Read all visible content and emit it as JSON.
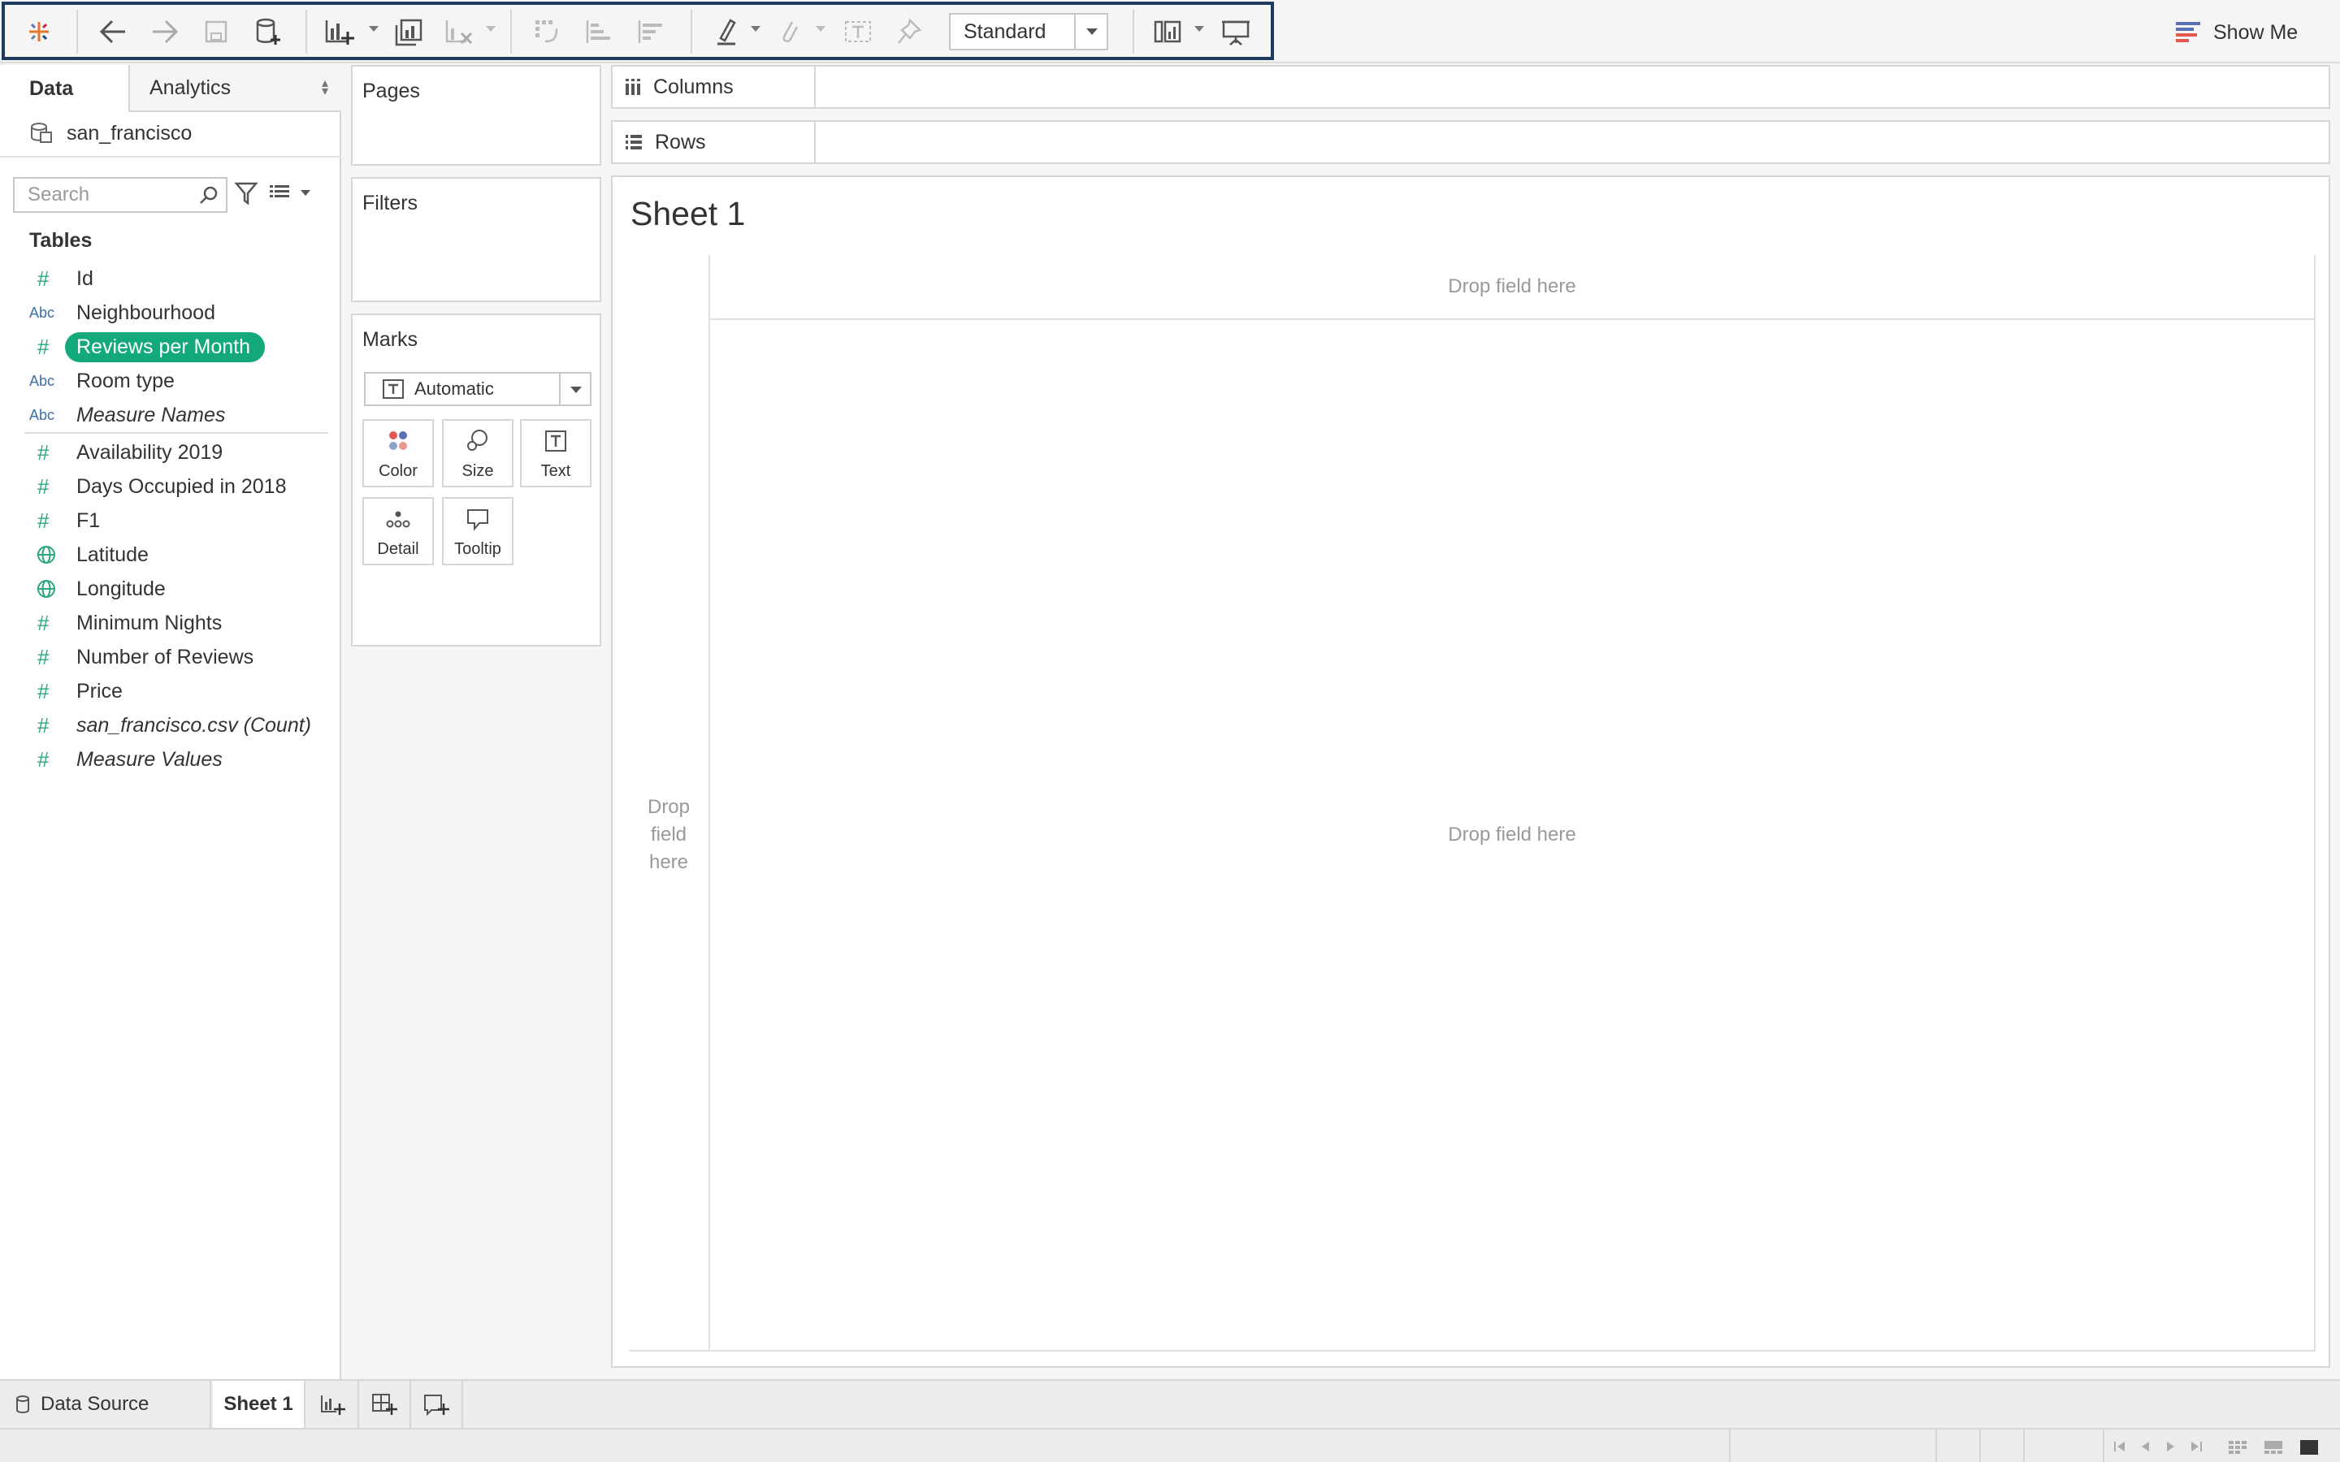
{
  "toolbar": {
    "view_size_value": "Standard",
    "show_me_label": "Show Me",
    "icons": [
      "tableau-logo-icon",
      "back-icon",
      "forward-icon",
      "save-icon",
      "new-datasource-icon",
      "new-worksheet-icon",
      "duplicate-sheet-icon",
      "clear-sheet-icon",
      "swap-icon",
      "sort-ascending-icon",
      "sort-descending-icon",
      "highlight-icon",
      "group-icon",
      "labels-icon",
      "pin-icon",
      "cards-icon",
      "presentation-icon"
    ]
  },
  "data_pane": {
    "tab_data": "Data",
    "tab_analytics": "Analytics",
    "datasource_name": "san_francisco",
    "search_placeholder": "Search",
    "tables_heading": "Tables",
    "fields": [
      {
        "type": "#",
        "label": "Id"
      },
      {
        "type": "Abc",
        "label": "Neighbourhood"
      },
      {
        "type": "#",
        "label": "Reviews per Month",
        "selected": true
      },
      {
        "type": "Abc",
        "label": "Room type"
      },
      {
        "type": "Abc",
        "label": "Measure Names",
        "italic": true
      },
      {
        "type": "#",
        "label": "Availability 2019"
      },
      {
        "type": "#",
        "label": "Days Occupied in 2018"
      },
      {
        "type": "#",
        "label": "F1"
      },
      {
        "type": "geo",
        "label": "Latitude"
      },
      {
        "type": "geo",
        "label": "Longitude"
      },
      {
        "type": "#",
        "label": "Minimum Nights"
      },
      {
        "type": "#",
        "label": "Number of Reviews"
      },
      {
        "type": "#",
        "label": "Price"
      },
      {
        "type": "#",
        "label": "san_francisco.csv (Count)",
        "italic": true
      },
      {
        "type": "#",
        "label": "Measure Values",
        "italic": true
      }
    ]
  },
  "shelves": {
    "pages": "Pages",
    "filters": "Filters",
    "marks": "Marks",
    "mark_type": "Automatic",
    "mark_buttons": [
      "Color",
      "Size",
      "Text",
      "Detail",
      "Tooltip"
    ],
    "columns": "Columns",
    "rows": "Rows"
  },
  "canvas": {
    "sheet_title": "Sheet 1",
    "drop_top": "Drop field here",
    "drop_left": "Drop field here",
    "drop_main": "Drop field here"
  },
  "bottom_tabs": {
    "data_source": "Data Source",
    "sheet1": "Sheet 1"
  },
  "colors": {
    "selection_green": "#13a97a",
    "toolbar_frame": "#1f3a5f"
  }
}
